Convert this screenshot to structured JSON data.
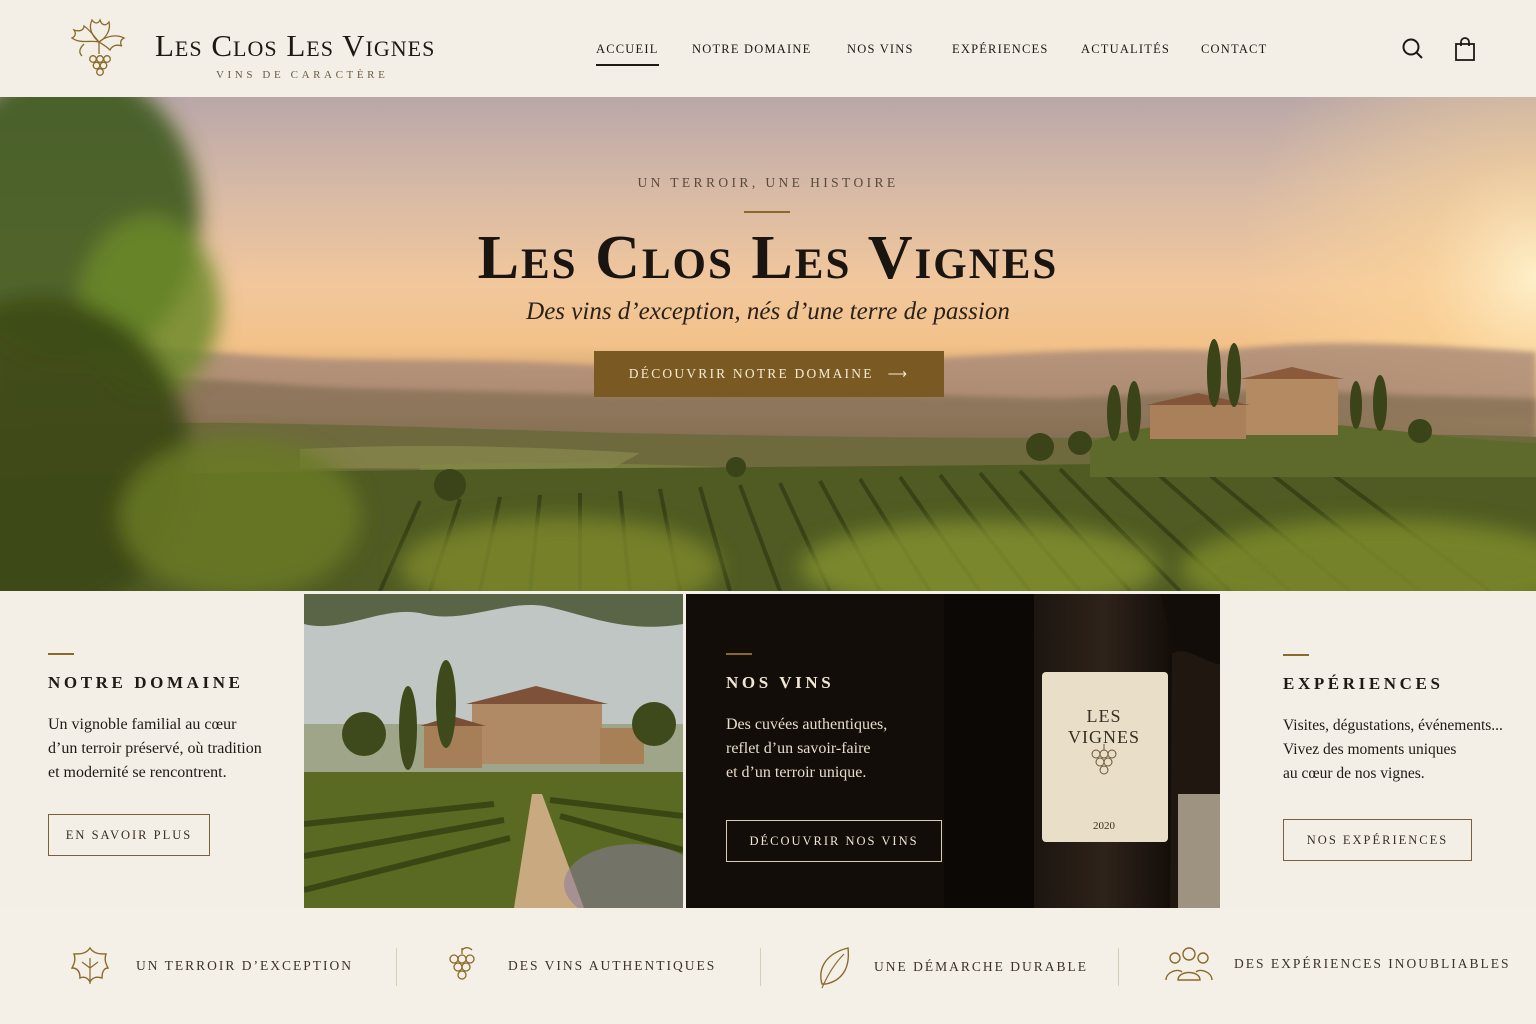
{
  "brand": {
    "name": "Les Clos Les Vignes",
    "tagline": "VINS DE CARACTÈRE"
  },
  "nav": {
    "items": [
      {
        "label": "ACCUEIL",
        "active": true
      },
      {
        "label": "NOTRE DOMAINE",
        "active": false
      },
      {
        "label": "NOS VINS",
        "active": false
      },
      {
        "label": "EXPÉRIENCES",
        "active": false
      },
      {
        "label": "ACTUALITÉS",
        "active": false
      },
      {
        "label": "CONTACT",
        "active": false
      }
    ],
    "icons": [
      "search-icon",
      "shopping-bag-icon"
    ]
  },
  "hero": {
    "kicker": "UN TERROIR, UNE HISTOIRE",
    "title": "Les Clos Les Vignes",
    "subtitle": "Des vins d’exception, nés d’une terre de passion",
    "cta_label": "DÉCOUVRIR NOTRE DOMAINE",
    "cta_arrow": "⟶"
  },
  "features": {
    "domaine": {
      "title": "NOTRE DOMAINE",
      "body": [
        "Un vignoble familial au cœur",
        "d’un terroir préservé, où tradition",
        "et modernité se rencontrent."
      ],
      "button": "EN SAVOIR PLUS"
    },
    "vins": {
      "title": "NOS VINS",
      "body": [
        "Des cuvées authentiques,",
        "reflet d’un savoir-faire",
        "et d’un terroir unique."
      ],
      "button": "DÉCOUVRIR NOS VINS",
      "bottle_label": {
        "name": "LES VIGNES",
        "year": "2020"
      }
    },
    "experiences": {
      "title": "EXPÉRIENCES",
      "body": [
        "Visites, dégustations, événements...",
        "Vivez des moments uniques",
        "au cœur de nos vignes."
      ],
      "button": "NOS EXPÉRIENCES"
    }
  },
  "strip": [
    {
      "icon": "vine-leaf-icon",
      "label": "UN TERROIR D’EXCEPTION"
    },
    {
      "icon": "grapes-icon",
      "label": "DES VINS AUTHENTIQUES"
    },
    {
      "icon": "leaf-icon",
      "label": "UNE DÉMARCHE DURABLE"
    },
    {
      "icon": "people-icon",
      "label": "DES EXPÉRIENCES INOUBLIABLES"
    }
  ],
  "colors": {
    "accent_gold": "#7a5a22",
    "background": "#f3efe7",
    "dark_card": "#130d09",
    "text_dark": "#1f1a14"
  }
}
